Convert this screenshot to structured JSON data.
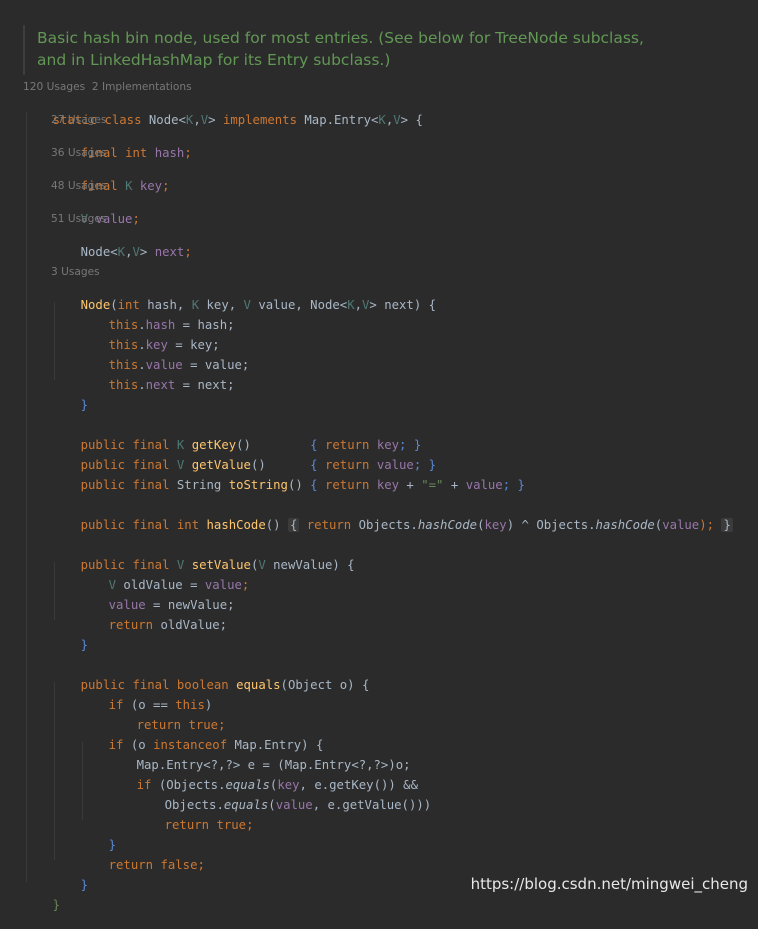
{
  "doc_comment": {
    "line1": "Basic hash bin node, used for most entries. (See below for TreeNode subclass,",
    "line2": "and in LinkedHashMap for its Entry subclass.)"
  },
  "class_hints": "120 Usages  2 Implementations",
  "hints": {
    "hash": "27 Usages",
    "key": "36 Usages",
    "value": "48 Usages",
    "next": "51 Usages",
    "ctor": "3 Usages"
  },
  "code": {
    "class_decl": [
      "static",
      " ",
      "class",
      " Node<",
      "K",
      ",",
      "V",
      "> ",
      "implements",
      " Map.Entry<",
      "K",
      ",",
      "V",
      "> {"
    ],
    "f_hash": [
      "final",
      " ",
      "int",
      " ",
      "hash",
      ";"
    ],
    "f_key": [
      "final",
      " ",
      "K",
      " ",
      "key",
      ";"
    ],
    "f_value": [
      "V",
      " ",
      "value",
      ";"
    ],
    "f_next": [
      "Node<",
      "K",
      ",",
      "V",
      "> ",
      "next",
      ";"
    ],
    "ctor": [
      "Node",
      "(",
      "int",
      " hash, ",
      "K",
      " key, ",
      "V",
      " value, Node<",
      "K",
      ",",
      "V",
      "> next) {"
    ],
    "a_hash": [
      "this",
      ".",
      "hash",
      " = hash;"
    ],
    "a_key": [
      "this",
      ".",
      "key",
      " = key;"
    ],
    "a_value": [
      "this",
      ".",
      "value",
      " = value;"
    ],
    "a_next": [
      "this",
      ".",
      "next",
      " = next;"
    ],
    "ctor_close": "}",
    "getKey": [
      "public",
      " ",
      "final",
      " ",
      "K",
      " ",
      "getKey",
      "()",
      "        { ",
      "return",
      " ",
      "key",
      "; }"
    ],
    "getValue": [
      "public",
      " ",
      "final",
      " ",
      "V",
      " ",
      "getValue",
      "()",
      "      { ",
      "return",
      " ",
      "value",
      "; }"
    ],
    "toString": [
      "public",
      " ",
      "final",
      " String ",
      "toString",
      "()",
      " { ",
      "return",
      " ",
      "key",
      " + ",
      "\"=\"",
      " + ",
      "value",
      "; }"
    ],
    "hashCode": [
      "public",
      " ",
      "final",
      " ",
      "int",
      " ",
      "hashCode",
      "()",
      " ",
      "{",
      " ",
      "return",
      " Objects.",
      "hashCode",
      "(",
      "key",
      ") ^ Objects.",
      "hashCode",
      "(",
      "value",
      ");",
      " ",
      "}"
    ],
    "setValue": [
      "public",
      " ",
      "final",
      " ",
      "V",
      " ",
      "setValue",
      "(",
      "V",
      " newValue) {"
    ],
    "sv_1": [
      "V",
      " oldValue = ",
      "value",
      ";"
    ],
    "sv_2": [
      "value",
      " = newValue;"
    ],
    "sv_3": [
      "return",
      " oldValue;"
    ],
    "sv_close": "}",
    "equals": [
      "public",
      " ",
      "final",
      " ",
      "boolean",
      " ",
      "equals",
      "(Object o) {"
    ],
    "eq_1": [
      "if",
      " (o == ",
      "this",
      ")"
    ],
    "eq_2": [
      "return",
      " ",
      "true",
      ";"
    ],
    "eq_3": [
      "if",
      " (o ",
      "instanceof",
      " Map.Entry) {"
    ],
    "eq_4": [
      "Map.Entry<?,?> e = (Map.Entry<?,?>)o;"
    ],
    "eq_5": [
      "if",
      " (Objects.",
      "equals",
      "(",
      "key",
      ", e.getKey()) &&"
    ],
    "eq_6": [
      "Objects.",
      "equals",
      "(",
      "value",
      ", e.getValue()))"
    ],
    "eq_7": [
      "return",
      " ",
      "true",
      ";"
    ],
    "eq_close_inner": "}",
    "eq_8": [
      "return",
      " ",
      "false",
      ";"
    ],
    "eq_close": "}",
    "class_close": "}"
  },
  "watermark": "https://blog.csdn.net/mingwei_cheng",
  "colors": {
    "background": "#2b2b2b",
    "keyword": "#cc7832",
    "field": "#9876aa",
    "method": "#ffc66d",
    "type_param": "#507874",
    "doc": "#629755",
    "string": "#6a8759",
    "default": "#a9b7c6"
  }
}
